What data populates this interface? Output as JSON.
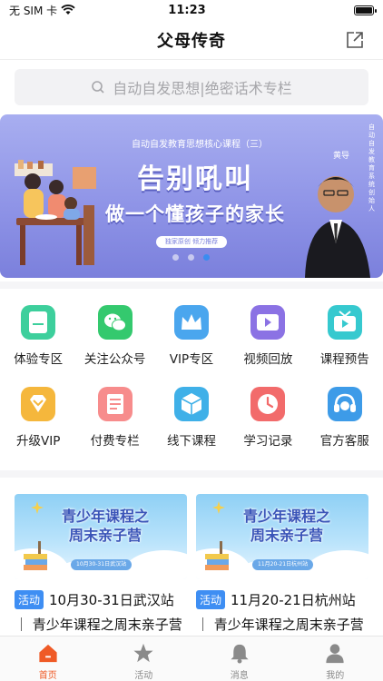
{
  "status_bar": {
    "carrier": "无 SIM 卡",
    "time": "11:23",
    "battery_level": 1.0
  },
  "nav": {
    "title": "父母传奇",
    "share_icon": "share-icon"
  },
  "search": {
    "placeholder": "自动自发思想|绝密话术专栏"
  },
  "banner": {
    "subtitle": "自动自发教育思想核心课程（三）",
    "headline": "告别吼叫",
    "headline2": "做一个懂孩子的家长",
    "tag": "独家原创  倾力推荐",
    "side_text": "自动自发教育系统创始人",
    "name": "黄导",
    "page_count": 3,
    "active_page": 3
  },
  "grid": [
    {
      "label": "体验专区",
      "icon": "tablet-icon",
      "color": "#3dcf9c"
    },
    {
      "label": "关注公众号",
      "icon": "wechat-icon",
      "color": "#34c96e"
    },
    {
      "label": "VIP专区",
      "icon": "crown-icon",
      "color": "#4aa6ee"
    },
    {
      "label": "视频回放",
      "icon": "video-play-icon",
      "color": "#8b72e4"
    },
    {
      "label": "课程预告",
      "icon": "tv-icon",
      "color": "#36c9cf"
    },
    {
      "label": "升级VIP",
      "icon": "diamond-icon",
      "color": "#f5b73c"
    },
    {
      "label": "付费专栏",
      "icon": "document-icon",
      "color": "#f78c8c"
    },
    {
      "label": "线下课程",
      "icon": "cube-icon",
      "color": "#3fb0e8"
    },
    {
      "label": "学习记录",
      "icon": "clock-icon",
      "color": "#f26b6b"
    },
    {
      "label": "官方客服",
      "icon": "headset-icon",
      "color": "#3d9be8"
    }
  ],
  "cards": [
    {
      "image_title_1": "青少年课程之",
      "image_title_2": "周末亲子营",
      "image_tag": "10月30-31日武汉站",
      "badge": "活动",
      "date": "10月30-31日武汉站",
      "title": "｜ 青少年课程之周末亲子营"
    },
    {
      "image_title_1": "青少年课程之",
      "image_title_2": "周末亲子营",
      "image_tag": "11月20-21日杭州站",
      "badge": "活动",
      "date": "11月20-21日杭州站",
      "title": "｜ 青少年课程之周末亲子营"
    }
  ],
  "tabs": [
    {
      "label": "首页",
      "icon": "home-icon",
      "active": true
    },
    {
      "label": "活动",
      "icon": "star-icon",
      "active": false
    },
    {
      "label": "消息",
      "icon": "bell-icon",
      "active": false
    },
    {
      "label": "我的",
      "icon": "person-icon",
      "active": false
    }
  ],
  "colors": {
    "accent": "#ef5a26",
    "badge": "#3e8ef3",
    "banner": "#8d92e6",
    "dot_active": "#3a8cf0"
  }
}
